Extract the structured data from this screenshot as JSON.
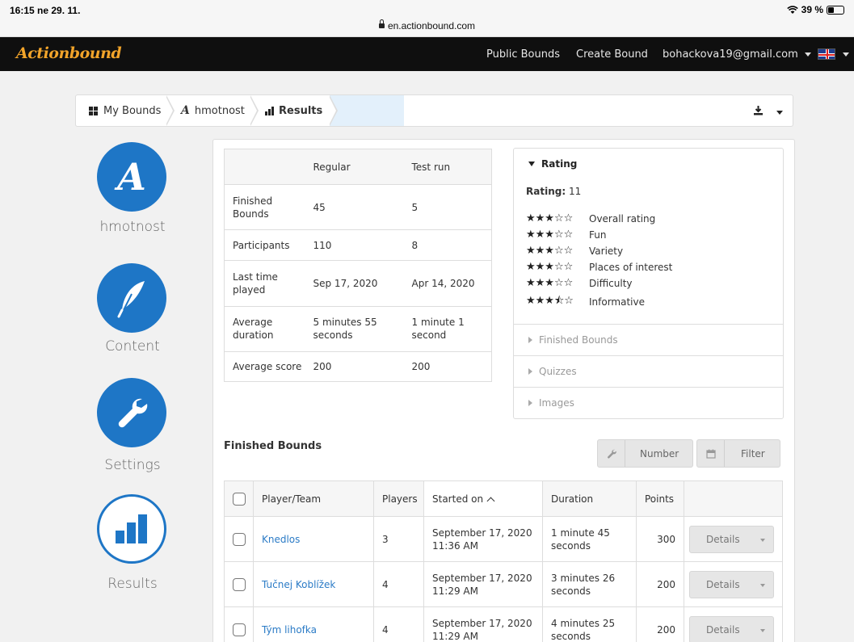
{
  "statusbar": {
    "time": "16:15  ne 29. 11.",
    "url": "en.actionbound.com",
    "battery": "39 %",
    "battery_level": 0.39
  },
  "nav": {
    "logo": "Actionbound",
    "public_bounds": "Public Bounds",
    "create_bound": "Create Bound",
    "user_email": "bohackova19@gmail.com"
  },
  "breadcrumb": {
    "my_bounds": "My Bounds",
    "bound": "hmotnost",
    "results": "Results"
  },
  "rail": {
    "bound_label": "hmotnost",
    "content_label": "Content",
    "settings_label": "Settings",
    "results_label": "Results"
  },
  "stats": {
    "headers": [
      "",
      "Regular",
      "Test run"
    ],
    "rows": [
      {
        "label": "Finished Bounds",
        "regular": "45",
        "test": "5"
      },
      {
        "label": "Participants",
        "regular": "110",
        "test": "8"
      },
      {
        "label": "Last time played",
        "regular": "Sep 17, 2020",
        "test": "Apr 14, 2020"
      },
      {
        "label": "Average duration",
        "regular": "5 minutes 55 seconds",
        "test": "1 minute 1 second"
      },
      {
        "label": "Average score",
        "regular": "200",
        "test": "200"
      }
    ]
  },
  "rating": {
    "title": "Rating",
    "rating_prefix": "Rating:",
    "rating_value": "11",
    "items": [
      {
        "stars": "★★★☆☆",
        "label": "Overall rating"
      },
      {
        "stars": "★★★☆☆",
        "label": "Fun"
      },
      {
        "stars": "★★★☆☆",
        "label": "Variety"
      },
      {
        "stars": "★★★☆☆",
        "label": "Places of interest"
      },
      {
        "stars": "★★★☆☆",
        "label": "Difficulty"
      },
      {
        "stars": "★★★⯪☆",
        "label": "Informative"
      }
    ],
    "sections": [
      "Finished Bounds",
      "Quizzes",
      "Images"
    ]
  },
  "finished": {
    "title": "Finished Bounds",
    "number_btn": "Number",
    "filter_btn": "Filter",
    "columns": [
      "Player/Team",
      "Players",
      "Started on",
      "Duration",
      "Points"
    ],
    "rows": [
      {
        "player": "Knedlos",
        "players": "3",
        "started_date": "September 17, 2020",
        "started_time": "11:36 AM",
        "duration": "1 minute 45 seconds",
        "points": "300",
        "details": "Details"
      },
      {
        "player": "Tučnej Koblížek",
        "players": "4",
        "started_date": "September 17, 2020",
        "started_time": "11:29 AM",
        "duration": "3 minutes 26 seconds",
        "points": "200",
        "details": "Details"
      },
      {
        "player": "Tým lihofka",
        "players": "4",
        "started_date": "September 17, 2020",
        "started_time": "11:29 AM",
        "duration": "4 minutes 25 seconds",
        "points": "200",
        "details": "Details"
      }
    ]
  }
}
